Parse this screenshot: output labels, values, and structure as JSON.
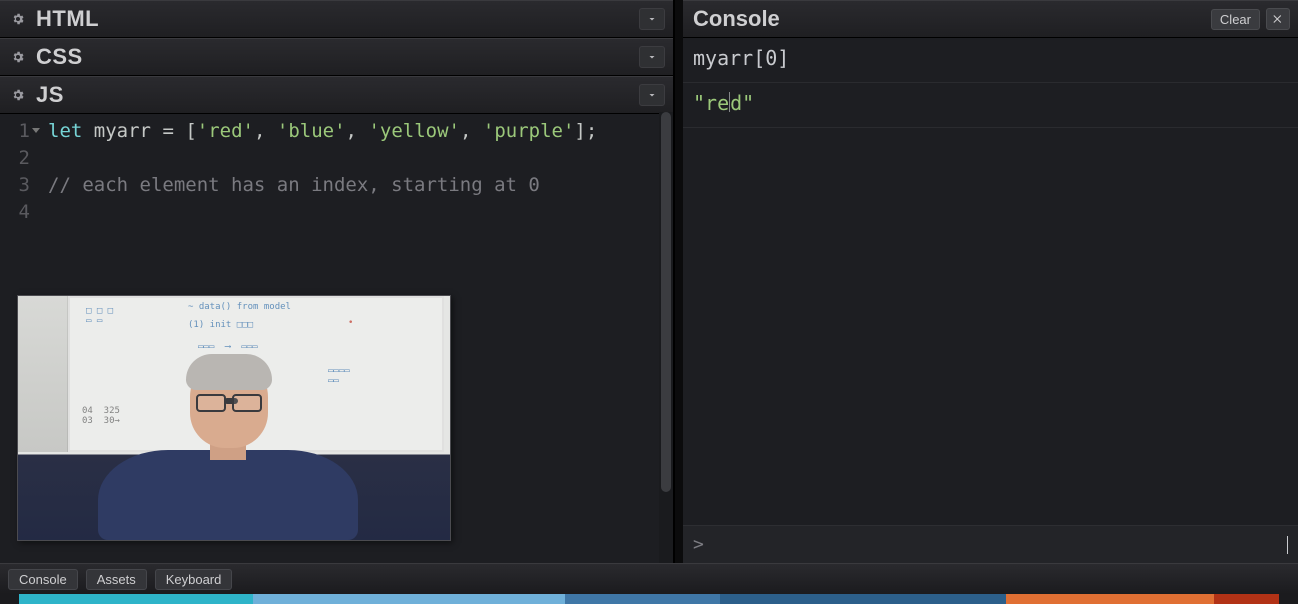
{
  "panels": {
    "html": {
      "title": "HTML"
    },
    "css": {
      "title": "CSS"
    },
    "js": {
      "title": "JS"
    }
  },
  "js_code": {
    "lines": [
      {
        "num": "1",
        "segments": [
          {
            "cls": "tok-kw",
            "text": "let"
          },
          {
            "cls": "",
            "text": " "
          },
          {
            "cls": "tok-var",
            "text": "myarr"
          },
          {
            "cls": "",
            "text": " "
          },
          {
            "cls": "tok-op",
            "text": "="
          },
          {
            "cls": "",
            "text": " "
          },
          {
            "cls": "tok-pn",
            "text": "["
          },
          {
            "cls": "tok-str",
            "text": "'red'"
          },
          {
            "cls": "tok-pn",
            "text": ","
          },
          {
            "cls": "",
            "text": " "
          },
          {
            "cls": "tok-str",
            "text": "'blue'"
          },
          {
            "cls": "tok-pn",
            "text": ","
          },
          {
            "cls": "",
            "text": " "
          },
          {
            "cls": "tok-str",
            "text": "'yellow'"
          },
          {
            "cls": "tok-pn",
            "text": ","
          },
          {
            "cls": "",
            "text": " "
          },
          {
            "cls": "tok-str",
            "text": "'purple'"
          },
          {
            "cls": "tok-pn",
            "text": "];"
          }
        ]
      },
      {
        "num": "2",
        "segments": [
          {
            "cls": "",
            "text": ""
          }
        ]
      },
      {
        "num": "3",
        "segments": [
          {
            "cls": "tok-cmt",
            "text": "// each element has an index, starting at 0"
          }
        ]
      },
      {
        "num": "4",
        "segments": [
          {
            "cls": "",
            "text": ""
          }
        ]
      }
    ]
  },
  "console": {
    "title": "Console",
    "clear_label": "Clear",
    "rows": [
      {
        "kind": "input",
        "text": "myarr[0]"
      },
      {
        "kind": "result",
        "text": "\"red\""
      }
    ],
    "prompt_symbol": ">",
    "input_value": ""
  },
  "bottom_bar": {
    "buttons": [
      "Console",
      "Assets",
      "Keyboard"
    ]
  },
  "color_strip": [
    {
      "color": "#1b1b1e",
      "flex": "0.015"
    },
    {
      "color": "#2eb4c9",
      "flex": "0.18"
    },
    {
      "color": "#6fb0d9",
      "flex": "0.24"
    },
    {
      "color": "#3f77a7",
      "flex": "0.12"
    },
    {
      "color": "#2c5f8a",
      "flex": "0.22"
    },
    {
      "color": "#e06f33",
      "flex": "0.16"
    },
    {
      "color": "#b23216",
      "flex": "0.05"
    },
    {
      "color": "#1b1b1e",
      "flex": "0.015"
    }
  ]
}
